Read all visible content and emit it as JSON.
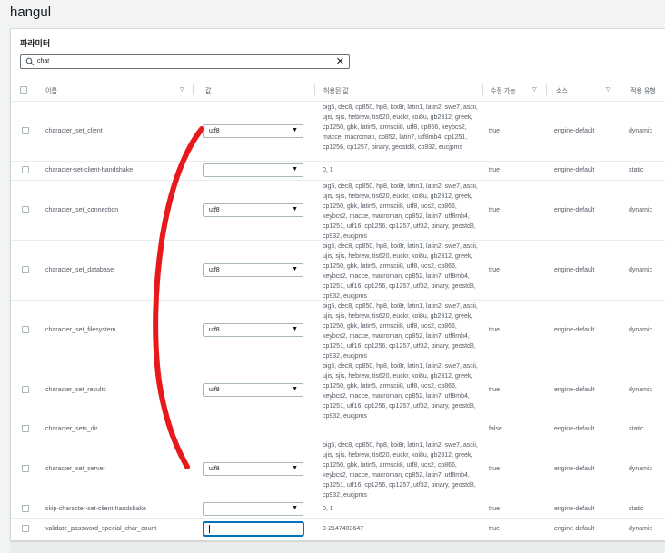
{
  "page": {
    "title": "hangul"
  },
  "panel": {
    "title": "파라미터"
  },
  "search": {
    "value": "char"
  },
  "table": {
    "headers": {
      "name": "이름",
      "value": "값",
      "allowed": "허용된 값",
      "modifiable": "수정 가능",
      "source": "소스",
      "apply_type": "적용 유형"
    },
    "rows": [
      {
        "name": "character_set_client",
        "value": "utf8",
        "control": "select",
        "allowed": "big5, dec8, cp850, hp8, koi8r, latin1, latin2, swe7, ascii, ujis, sjis, hebrew, tis620, euckr, koi8u, gb2312, greek, cp1250, gbk, latin5, armscii8, utf8, cp866, keybcs2, macce, macroman, cp852, latin7, utf8mb4, cp1251, cp1256, cp1257, binary, geostd8, cp932, eucjpms",
        "modifiable": "true",
        "source": "engine-default",
        "apply_type": "dynamic"
      },
      {
        "name": "character-set-client-handshake",
        "value": "",
        "control": "select",
        "allowed": "0, 1",
        "modifiable": "true",
        "source": "engine-default",
        "apply_type": "static"
      },
      {
        "name": "character_set_connection",
        "value": "utf8",
        "control": "select",
        "allowed": "big5, dec8, cp850, hp8, koi8r, latin1, latin2, swe7, ascii, ujis, sjis, hebrew, tis620, euckr, koi8u, gb2312, greek, cp1250, gbk, latin5, armscii8, utf8, ucs2, cp866, keybcs2, macce, macroman, cp852, latin7, utf8mb4, cp1251, utf16, cp1256, cp1257, utf32, binary, geostd8, cp932, eucjpms",
        "modifiable": "true",
        "source": "engine-default",
        "apply_type": "dynamic"
      },
      {
        "name": "character_set_database",
        "value": "utf8",
        "control": "select",
        "allowed": "big5, dec8, cp850, hp8, koi8r, latin1, latin2, swe7, ascii, ujis, sjis, hebrew, tis620, euckr, koi8u, gb2312, greek, cp1250, gbk, latin5, armscii8, utf8, ucs2, cp866, keybcs2, macce, macroman, cp852, latin7, utf8mb4, cp1251, utf16, cp1256, cp1257, utf32, binary, geostd8, cp932, eucjpms",
        "modifiable": "true",
        "source": "engine-default",
        "apply_type": "dynamic"
      },
      {
        "name": "character_set_filesystem",
        "value": "utf8",
        "control": "select",
        "allowed": "big5, dec8, cp850, hp8, koi8r, latin1, latin2, swe7, ascii, ujis, sjis, hebrew, tis620, euckr, koi8u, gb2312, greek, cp1250, gbk, latin5, armscii8, utf8, ucs2, cp866, keybcs2, macce, macroman, cp852, latin7, utf8mb4, cp1251, utf16, cp1256, cp1257, utf32, binary, geostd8, cp932, eucjpms",
        "modifiable": "true",
        "source": "engine-default",
        "apply_type": "dynamic"
      },
      {
        "name": "character_set_results",
        "value": "utf8",
        "control": "select",
        "allowed": "big5, dec8, cp850, hp8, koi8r, latin1, latin2, swe7, ascii, ujis, sjis, hebrew, tis620, euckr, koi8u, gb2312, greek, cp1250, gbk, latin5, armscii8, utf8, ucs2, cp866, keybcs2, macce, macroman, cp852, latin7, utf8mb4, cp1251, utf16, cp1256, cp1257, utf32, binary, geostd8, cp932, eucjpms",
        "modifiable": "true",
        "source": "engine-default",
        "apply_type": "dynamic"
      },
      {
        "name": "character_sets_dir",
        "value": "",
        "control": "none",
        "allowed": "",
        "modifiable": "false",
        "source": "engine-default",
        "apply_type": "static"
      },
      {
        "name": "character_set_server",
        "value": "utf8",
        "control": "select",
        "allowed": "big5, dec8, cp850, hp8, koi8r, latin1, latin2, swe7, ascii, ujis, sjis, hebrew, tis620, euckr, koi8u, gb2312, greek, cp1250, gbk, latin5, armscii8, utf8, ucs2, cp866, keybcs2, macce, macroman, cp852, latin7, utf8mb4, cp1251, utf16, cp1256, cp1257, utf32, binary, geostd8, cp932, eucjpms",
        "modifiable": "true",
        "source": "engine-default",
        "apply_type": "dynamic"
      },
      {
        "name": "skip-character-set-client-handshake",
        "value": "",
        "control": "select",
        "allowed": "0, 1",
        "modifiable": "true",
        "source": "engine-default",
        "apply_type": "static"
      },
      {
        "name": "validate_password_special_char_count",
        "value": "",
        "control": "input",
        "allowed": "0-2147483647",
        "modifiable": "true",
        "source": "engine-default",
        "apply_type": "dynamic"
      }
    ]
  },
  "colors": {
    "annotation": "#e8191b",
    "focus": "#0073bb"
  }
}
